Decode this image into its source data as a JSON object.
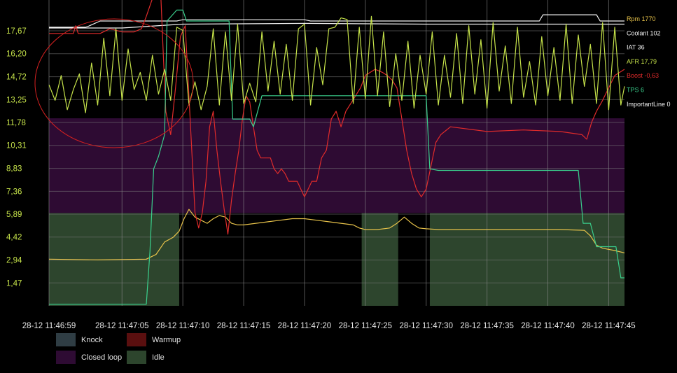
{
  "chart_data": {
    "type": "line",
    "x_tick_labels": [
      "28-12 11:46:59",
      "28-12 11:47:05",
      "28-12 11:47:10",
      "28-12 11:47:15",
      "28-12 11:47:20",
      "28-12 11:47:25",
      "28-12 11:47:30",
      "28-12 11:47:35",
      "28-12 11:47:40",
      "28-12 11:47:45"
    ],
    "x_tick_seconds": [
      59,
      65,
      70,
      75,
      80,
      85,
      90,
      95,
      100,
      105
    ],
    "xlim": [
      59,
      106.3
    ],
    "y_tick_labels": [
      "1,47",
      "2,94",
      "4,42",
      "5,89",
      "7,36",
      "8,83",
      "10,31",
      "11,78",
      "13,25",
      "14,72",
      "16,20",
      "17,67"
    ],
    "ylim": [
      0,
      19.2
    ],
    "grid": true,
    "legend_position": "bottom-left",
    "band_legend": [
      {
        "name": "Knock",
        "color": "#2f3d44"
      },
      {
        "name": "Warmup",
        "color": "#5a0f0f"
      },
      {
        "name": "Closed loop",
        "color": "#2e0b33"
      },
      {
        "name": "Idle",
        "color": "#2d452d"
      }
    ],
    "bands": [
      {
        "name": "Closed loop",
        "y_range": [
          5.96,
          12.05
        ],
        "x_range": [
          59,
          106.3
        ]
      },
      {
        "name": "Idle",
        "y_range": [
          0,
          5.96
        ],
        "x_range": [
          59,
          69.7
        ]
      },
      {
        "name": "Idle",
        "y_range": [
          0,
          5.96
        ],
        "x_range": [
          84.7,
          87.7
        ]
      },
      {
        "name": "Idle",
        "y_range": [
          0,
          5.96
        ],
        "x_range": [
          90.3,
          106.3
        ]
      }
    ],
    "series_labels": [
      {
        "name": "Rpm",
        "value": "1770",
        "color": "#e7c24a"
      },
      {
        "name": "Coolant",
        "value": "102",
        "color": "#f2f2f2"
      },
      {
        "name": "IAT",
        "value": "36",
        "color": "#f2f2f2"
      },
      {
        "name": "AFR",
        "value": "17,79",
        "color": "#c6e34a"
      },
      {
        "name": "Boost",
        "value": "-0,63",
        "color": "#e02b2b"
      },
      {
        "name": "TPS",
        "value": "6",
        "color": "#3ad08d"
      },
      {
        "name": "ImportantLine",
        "value": "0",
        "color": "#f2f2f2"
      }
    ],
    "series": [
      {
        "name": "Rpm",
        "color": "#e7c24a",
        "points": [
          [
            59,
            3.0
          ],
          [
            63,
            2.95
          ],
          [
            67,
            3.0
          ],
          [
            67.8,
            3.3
          ],
          [
            68.5,
            4.1
          ],
          [
            69.2,
            4.4
          ],
          [
            69.7,
            4.8
          ],
          [
            70.1,
            5.6
          ],
          [
            70.5,
            6.2
          ],
          [
            71,
            5.7
          ],
          [
            71.5,
            5.5
          ],
          [
            72,
            5.3
          ],
          [
            72.5,
            5.6
          ],
          [
            73,
            5.8
          ],
          [
            73.5,
            5.7
          ],
          [
            74,
            5.3
          ],
          [
            74.5,
            5.2
          ],
          [
            75,
            5.2
          ],
          [
            76,
            5.3
          ],
          [
            77,
            5.4
          ],
          [
            78,
            5.5
          ],
          [
            79,
            5.6
          ],
          [
            80,
            5.6
          ],
          [
            81,
            5.5
          ],
          [
            82,
            5.4
          ],
          [
            83,
            5.3
          ],
          [
            84,
            5.2
          ],
          [
            84.5,
            5.0
          ],
          [
            85,
            4.9
          ],
          [
            86,
            4.9
          ],
          [
            87,
            5.0
          ],
          [
            87.6,
            5.3
          ],
          [
            88.2,
            5.7
          ],
          [
            88.8,
            5.3
          ],
          [
            89.4,
            5.0
          ],
          [
            90,
            4.95
          ],
          [
            91,
            4.9
          ],
          [
            93,
            4.9
          ],
          [
            95,
            4.9
          ],
          [
            97,
            4.9
          ],
          [
            99,
            4.9
          ],
          [
            101,
            4.9
          ],
          [
            103,
            4.85
          ],
          [
            103.5,
            4.5
          ],
          [
            104,
            3.9
          ],
          [
            104.5,
            3.7
          ],
          [
            105.5,
            3.55
          ],
          [
            106.3,
            3.4
          ]
        ]
      },
      {
        "name": "Coolant",
        "color": "#f2f2f2",
        "points": [
          [
            59,
            17.9
          ],
          [
            62,
            17.9
          ],
          [
            62.2,
            17.95
          ],
          [
            63.2,
            18.3
          ],
          [
            65,
            18.3
          ],
          [
            69.5,
            18.3
          ],
          [
            70,
            18.38
          ],
          [
            72,
            18.38
          ],
          [
            80,
            18.38
          ],
          [
            80.5,
            18.3
          ],
          [
            82,
            18.3
          ],
          [
            94,
            18.3
          ],
          [
            99.3,
            18.3
          ],
          [
            99.6,
            18.7
          ],
          [
            102,
            18.7
          ],
          [
            104,
            18.7
          ],
          [
            104.3,
            18.3
          ],
          [
            106.3,
            18.3
          ]
        ]
      },
      {
        "name": "IAT",
        "color": "#f2f2f2",
        "points": [
          [
            59,
            17.85
          ],
          [
            62,
            17.85
          ],
          [
            65,
            17.85
          ],
          [
            70,
            18.1
          ],
          [
            80,
            18.15
          ],
          [
            90,
            18.1
          ],
          [
            100,
            18.1
          ],
          [
            106.3,
            18.1
          ]
        ]
      },
      {
        "name": "Boost",
        "color": "#e02b2b",
        "points": [
          [
            59,
            17.5
          ],
          [
            61,
            17.5
          ],
          [
            61.2,
            18.0
          ],
          [
            61.4,
            17.5
          ],
          [
            62.5,
            17.5
          ],
          [
            63.2,
            17.5
          ],
          [
            64,
            17.8
          ],
          [
            65,
            17.6
          ],
          [
            66,
            17.6
          ],
          [
            66.6,
            17.8
          ],
          [
            67,
            18.6
          ],
          [
            67.5,
            20
          ],
          [
            68.2,
            20
          ],
          [
            68.4,
            16
          ],
          [
            68.6,
            12.5
          ],
          [
            69,
            11.0
          ],
          [
            69.4,
            14.0
          ],
          [
            69.8,
            17.3
          ],
          [
            70.2,
            18.0
          ],
          [
            70.6,
            12.0
          ],
          [
            71,
            6.0
          ],
          [
            71.3,
            5.0
          ],
          [
            71.6,
            6.0
          ],
          [
            71.9,
            8.0
          ],
          [
            72.2,
            11.5
          ],
          [
            72.5,
            12.5
          ],
          [
            72.8,
            10.0
          ],
          [
            73.1,
            8.0
          ],
          [
            73.4,
            6.2
          ],
          [
            73.7,
            4.6
          ],
          [
            74,
            6.8
          ],
          [
            74.3,
            8.5
          ],
          [
            74.6,
            10.0
          ],
          [
            74.9,
            12.0
          ],
          [
            75.2,
            13.5
          ],
          [
            75.5,
            13.1
          ],
          [
            75.8,
            11.5
          ],
          [
            76.1,
            10.0
          ],
          [
            76.4,
            9.5
          ],
          [
            77.2,
            9.5
          ],
          [
            77.5,
            8.8
          ],
          [
            77.8,
            8.5
          ],
          [
            78.1,
            8.8
          ],
          [
            78.4,
            8.5
          ],
          [
            78.7,
            8.0
          ],
          [
            79.4,
            8.0
          ],
          [
            79.7,
            7.5
          ],
          [
            80,
            7.0
          ],
          [
            80.6,
            8.0
          ],
          [
            81,
            8.0
          ],
          [
            81.4,
            9.5
          ],
          [
            81.8,
            10.0
          ],
          [
            82.2,
            12.0
          ],
          [
            82.6,
            12.5
          ],
          [
            83,
            11.5
          ],
          [
            83.4,
            12.5
          ],
          [
            83.8,
            13.0
          ],
          [
            84.2,
            13.5
          ],
          [
            84.6,
            14.0
          ],
          [
            85,
            14.8
          ],
          [
            85.8,
            15.2
          ],
          [
            86.4,
            15.0
          ],
          [
            86.8,
            14.8
          ],
          [
            87.2,
            14.5
          ],
          [
            87.6,
            14.0
          ],
          [
            88,
            12.0
          ],
          [
            88.4,
            10.0
          ],
          [
            88.8,
            8.5
          ],
          [
            89.2,
            7.5
          ],
          [
            89.6,
            7.0
          ],
          [
            90,
            7.5
          ],
          [
            90.4,
            9.0
          ],
          [
            90.8,
            10.5
          ],
          [
            91.2,
            11.0
          ],
          [
            92,
            11.5
          ],
          [
            95,
            11.2
          ],
          [
            98,
            11.3
          ],
          [
            101,
            11.2
          ],
          [
            102.8,
            11.0
          ],
          [
            103.2,
            10.7
          ],
          [
            103.6,
            11.8
          ],
          [
            104,
            12.5
          ],
          [
            104.5,
            13.2
          ],
          [
            105,
            14.0
          ],
          [
            105.5,
            14.8
          ],
          [
            106.3,
            15.2
          ]
        ]
      },
      {
        "name": "TPS",
        "color": "#3ad08d",
        "points": [
          [
            59,
            0.1
          ],
          [
            67,
            0.1
          ],
          [
            67.3,
            3.5
          ],
          [
            67.6,
            8.8
          ],
          [
            68,
            9.6
          ],
          [
            68.5,
            11.0
          ],
          [
            68.7,
            18.3
          ],
          [
            69.5,
            19.0
          ],
          [
            70,
            19.0
          ],
          [
            70.3,
            18.3
          ],
          [
            73.8,
            18.3
          ],
          [
            74.1,
            12.0
          ],
          [
            75.5,
            12.0
          ],
          [
            75.8,
            11.5
          ],
          [
            76.5,
            13.5
          ],
          [
            84.8,
            13.5
          ],
          [
            90,
            13.5
          ],
          [
            90.3,
            8.8
          ],
          [
            91,
            8.7
          ],
          [
            97,
            8.7
          ],
          [
            102.5,
            8.7
          ],
          [
            102.9,
            5.3
          ],
          [
            103.5,
            5.3
          ],
          [
            104,
            3.8
          ],
          [
            105.6,
            3.8
          ],
          [
            106,
            1.8
          ],
          [
            106.3,
            1.8
          ]
        ]
      },
      {
        "name": "AFR",
        "color": "#c6e34a",
        "points": [
          [
            59,
            14.2
          ],
          [
            59.5,
            13.2
          ],
          [
            60,
            14.8
          ],
          [
            60.5,
            12.6
          ],
          [
            61,
            13.9
          ],
          [
            61.5,
            14.9
          ],
          [
            62,
            12.4
          ],
          [
            62.5,
            15.6
          ],
          [
            63,
            12.9
          ],
          [
            63.5,
            17.2
          ],
          [
            64,
            13.5
          ],
          [
            64.5,
            17.8
          ],
          [
            65,
            13.2
          ],
          [
            65.5,
            16.5
          ],
          [
            66,
            13.9
          ],
          [
            66.5,
            15.0
          ],
          [
            67,
            13.2
          ],
          [
            67.5,
            16.1
          ],
          [
            68,
            13.6
          ],
          [
            68.5,
            15.2
          ],
          [
            69,
            13.2
          ],
          [
            69.5,
            17.9
          ],
          [
            70,
            17.7
          ],
          [
            70.5,
            12.9
          ],
          [
            71,
            14.4
          ],
          [
            71.5,
            12.6
          ],
          [
            72,
            14.1
          ],
          [
            72.5,
            17.8
          ],
          [
            73,
            12.9
          ],
          [
            73.5,
            17.6
          ],
          [
            74,
            13.2
          ],
          [
            74.5,
            18.1
          ],
          [
            75,
            13.0
          ],
          [
            75.5,
            14.3
          ],
          [
            76,
            13.1
          ],
          [
            76.5,
            17.6
          ],
          [
            77,
            13.8
          ],
          [
            77.5,
            17.0
          ],
          [
            78,
            13.6
          ],
          [
            78.5,
            16.8
          ],
          [
            79,
            13.2
          ],
          [
            79.5,
            17.8
          ],
          [
            80,
            18.1
          ],
          [
            80.5,
            12.9
          ],
          [
            81,
            16.6
          ],
          [
            81.5,
            14.2
          ],
          [
            82,
            17.8
          ],
          [
            82.5,
            17.9
          ],
          [
            83,
            18.5
          ],
          [
            83.5,
            18.4
          ],
          [
            84,
            13.0
          ],
          [
            84.5,
            17.9
          ],
          [
            85,
            13.3
          ],
          [
            85.5,
            18.6
          ],
          [
            86,
            13.5
          ],
          [
            86.5,
            17.6
          ],
          [
            87,
            12.8
          ],
          [
            87.5,
            16.2
          ],
          [
            88,
            13.2
          ],
          [
            88.5,
            17.0
          ],
          [
            89,
            12.7
          ],
          [
            89.5,
            16.1
          ],
          [
            90,
            13.6
          ],
          [
            90.5,
            17.6
          ],
          [
            91,
            12.9
          ],
          [
            91.5,
            16.1
          ],
          [
            92,
            13.4
          ],
          [
            92.5,
            17.5
          ],
          [
            93,
            13.0
          ],
          [
            93.5,
            18.0
          ],
          [
            94,
            13.6
          ],
          [
            94.5,
            17.1
          ],
          [
            95,
            12.7
          ],
          [
            95.5,
            18.2
          ],
          [
            96,
            13.8
          ],
          [
            96.5,
            16.7
          ],
          [
            97,
            13.0
          ],
          [
            97.5,
            17.9
          ],
          [
            98,
            13.4
          ],
          [
            98.5,
            15.7
          ],
          [
            99,
            12.9
          ],
          [
            99.5,
            17.3
          ],
          [
            100,
            13.5
          ],
          [
            100.5,
            16.6
          ],
          [
            101,
            13.2
          ],
          [
            101.5,
            18.1
          ],
          [
            102,
            13.0
          ],
          [
            102.5,
            17.4
          ],
          [
            103,
            14.1
          ],
          [
            103.5,
            16.8
          ],
          [
            104,
            13.0
          ],
          [
            104.5,
            18.2
          ],
          [
            105,
            12.6
          ],
          [
            105.5,
            17.9
          ],
          [
            106,
            12.9
          ],
          [
            106.3,
            14.1
          ]
        ]
      }
    ]
  }
}
